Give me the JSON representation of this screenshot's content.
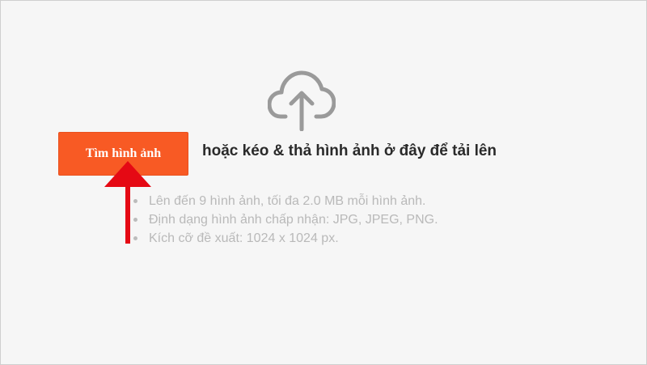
{
  "upload": {
    "icon": "cloud-upload-icon",
    "button_label": "Tìm hình ảnh",
    "drop_text": "hoặc kéo & thả hình ảnh ở đây để tải lên"
  },
  "hints": [
    "Lên đến 9 hình ảnh, tối đa 2.0 MB mỗi hình ảnh.",
    "Định dạng hình ảnh chấp nhận: JPG, JPEG, PNG.",
    "Kích cỡ đề xuất: 1024 x 1024 px."
  ],
  "annotation": {
    "icon": "red-arrow-icon",
    "color": "#e50914"
  },
  "colors": {
    "accent": "#f85a24",
    "background": "#f6f6f6"
  }
}
